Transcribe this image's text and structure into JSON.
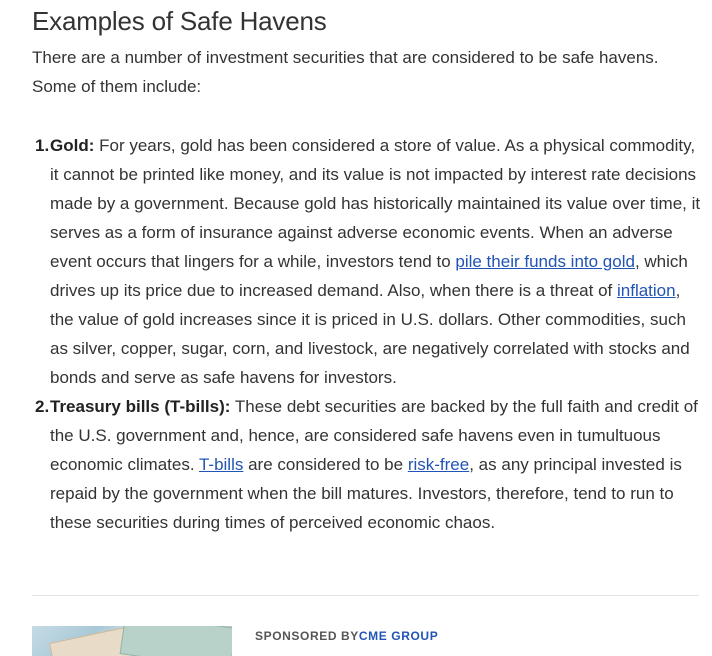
{
  "article": {
    "heading": "Examples of Safe Havens",
    "intro": "There are a number of investment securities that are considered to be safe havens. Some of them include:",
    "items": [
      {
        "number": "1.",
        "term": "Gold:",
        "text_1": " For years, gold has been considered a store of value. As a physical commodity, it cannot be printed like money, and its value is not impacted by interest rate decisions made by a government. Because gold has historically maintained its value over time, it serves as a form of insurance against adverse economic events. When an adverse event occurs that lingers for a while, investors tend to ",
        "link_1": "pile their funds into gold",
        "text_2": ", which drives up its price due to increased demand. Also, when there is a threat of ",
        "link_2": "inflation",
        "text_3": ", the value of gold increases since it is priced in U.S. dollars. Other commodities, such as silver, copper, sugar, corn, and livestock, are negatively correlated with stocks and bonds and serve as safe havens for investors."
      },
      {
        "number": "2.",
        "term": "Treasury bills (T-bills):",
        "text_1": " These debt securities are backed by the full faith and credit of the U.S. government and, hence, are considered safe havens even in tumultuous economic climates. ",
        "link_1": "T-bills",
        "text_2": " are considered to be ",
        "link_2": "risk-free",
        "text_3": ", as any principal invested is repaid by the government when the bill matures. Investors, therefore, tend to run to these securities during times of perceived economic chaos."
      }
    ]
  },
  "sponsored": {
    "prefix": "SPONSORED BY",
    "sponsor": "CME GROUP",
    "image_icon": "currency-notes-image"
  },
  "colors": {
    "text": "#333333",
    "link": "#2154b5",
    "divider": "#e3e3e3"
  }
}
